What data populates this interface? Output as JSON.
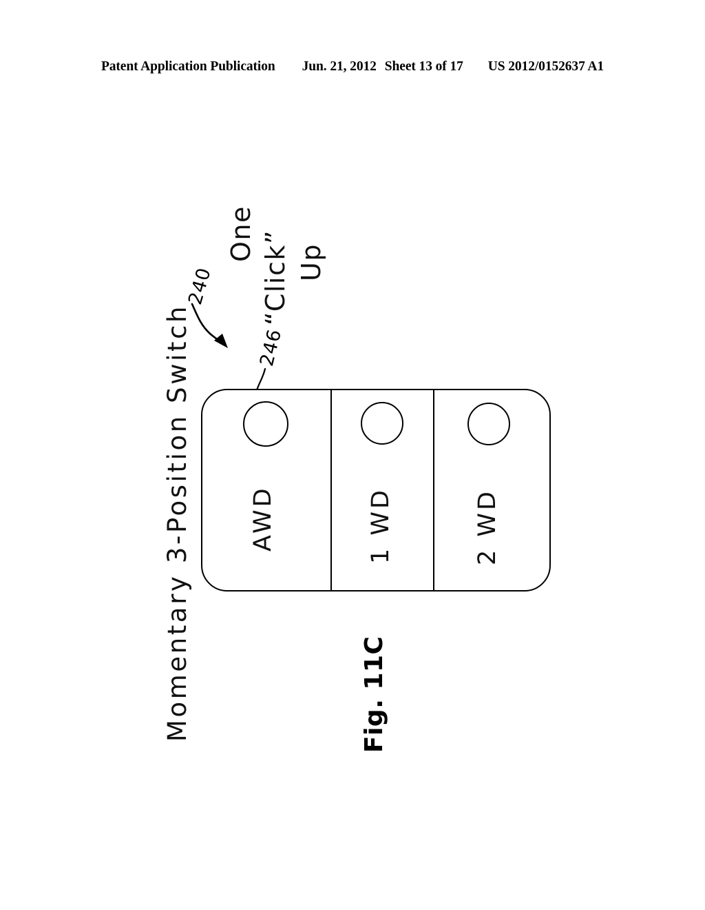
{
  "header": {
    "publication": "Patent Application Publication",
    "date": "Jun. 21, 2012",
    "sheet": "Sheet 13 of 17",
    "pub_number": "US 2012/0152637 A1"
  },
  "figure": {
    "title": "Momentary 3-Position Switch",
    "caption": "Fig. 11C",
    "annotation": {
      "line1": "One",
      "line2": "“Click”",
      "line3": "Up"
    },
    "reference_numerals": [
      {
        "id": "240",
        "label": "240",
        "points_to": "switch-assembly"
      },
      {
        "id": "246",
        "label": "246",
        "points_to": "awd-position-indicator"
      }
    ],
    "switch": {
      "positions": [
        {
          "label": "AWD",
          "indicator": "circle"
        },
        {
          "label": "1 WD",
          "indicator": "circle"
        },
        {
          "label": "2 WD",
          "indicator": "circle"
        }
      ]
    }
  },
  "colors": {
    "ink": "#000000",
    "paper": "#ffffff"
  }
}
